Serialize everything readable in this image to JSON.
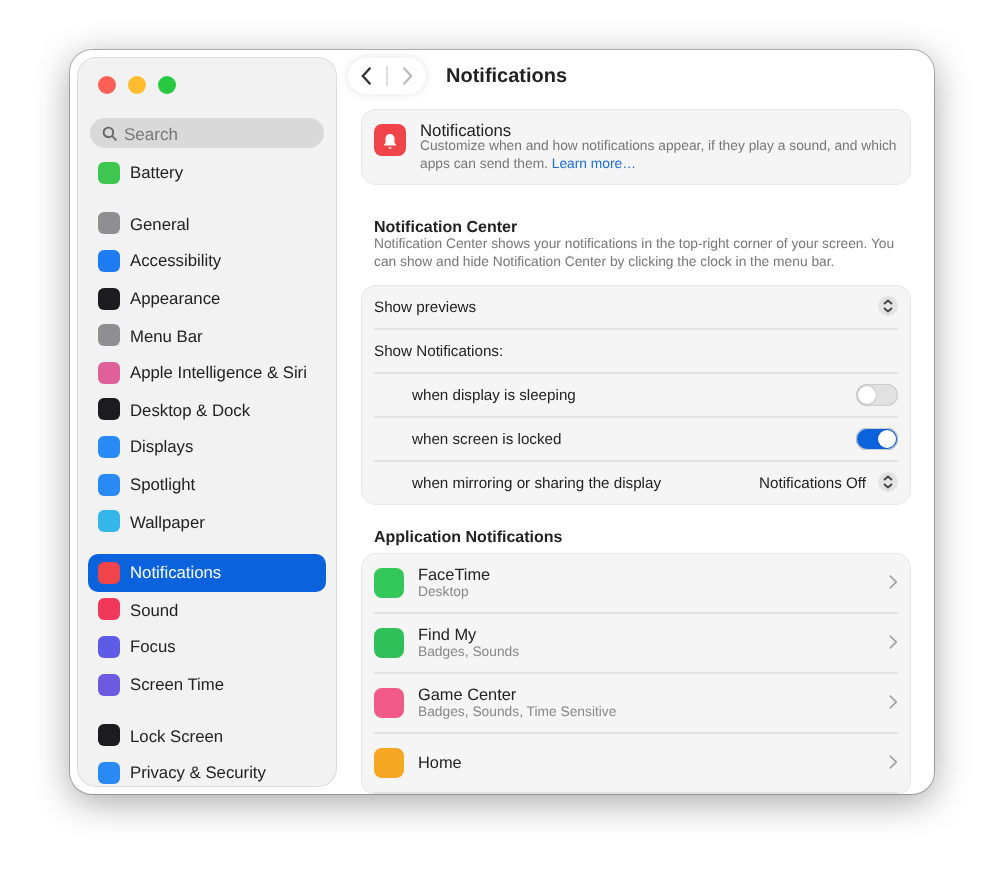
{
  "window": {
    "title": "Notifications"
  },
  "sidebar": {
    "search": {
      "placeholder": "Search"
    },
    "groups": [
      [
        {
          "label": "Battery",
          "color": "#3fc650",
          "selected": false
        }
      ],
      [
        {
          "label": "General",
          "color": "#8e8e93",
          "selected": false
        },
        {
          "label": "Accessibility",
          "color": "#1e7cf2",
          "selected": false
        },
        {
          "label": "Appearance",
          "color": "#1c1c1e",
          "selected": false
        },
        {
          "label": "Menu Bar",
          "color": "#8e8e93",
          "selected": false
        },
        {
          "label": "Apple Intelligence & Siri",
          "color": "#e0609a",
          "selected": false
        },
        {
          "label": "Desktop & Dock",
          "color": "#1c1c1e",
          "selected": false
        },
        {
          "label": "Displays",
          "color": "#2a8af5",
          "selected": false
        },
        {
          "label": "Spotlight",
          "color": "#2a8af5",
          "selected": false
        },
        {
          "label": "Wallpaper",
          "color": "#35b6e8",
          "selected": false
        }
      ],
      [
        {
          "label": "Notifications",
          "color": "#f0444a",
          "selected": true
        },
        {
          "label": "Sound",
          "color": "#f0385a",
          "selected": false
        },
        {
          "label": "Focus",
          "color": "#5e5ce6",
          "selected": false
        },
        {
          "label": "Screen Time",
          "color": "#6e5ae0",
          "selected": false
        }
      ],
      [
        {
          "label": "Lock Screen",
          "color": "#1c1c1e",
          "selected": false
        },
        {
          "label": "Privacy & Security",
          "color": "#2a8af5",
          "selected": false
        }
      ]
    ]
  },
  "intro": {
    "title": "Notifications",
    "text": "Customize when and how notifications appear, if they play a sound, and which apps can send them.",
    "link": "Learn more…"
  },
  "notification_center": {
    "title": "Notification Center",
    "description": "Notification Center shows your notifications in the top-right corner of your screen. You can show and hide Notification Center by clicking the clock in the menu bar.",
    "rows": [
      {
        "kind": "popup",
        "label": "Show previews"
      },
      {
        "kind": "heading",
        "label": "Show Notifications:"
      },
      {
        "kind": "toggle",
        "label": "when display is sleeping",
        "on": false
      },
      {
        "kind": "toggle",
        "label": "when screen is locked",
        "on": true
      },
      {
        "kind": "popup",
        "label": "when mirroring or sharing the display",
        "value": "Notifications Off"
      }
    ]
  },
  "application_notifications": {
    "title": "Application Notifications",
    "apps": [
      {
        "name": "FaceTime",
        "detail": "Desktop",
        "color": "#34c759"
      },
      {
        "name": "Find My",
        "detail": "Badges, Sounds",
        "color": "#30c05a"
      },
      {
        "name": "Game Center",
        "detail": "Badges, Sounds, Time Sensitive",
        "color": "#f25a8a"
      },
      {
        "name": "Home",
        "color": "#f5a623"
      }
    ]
  }
}
